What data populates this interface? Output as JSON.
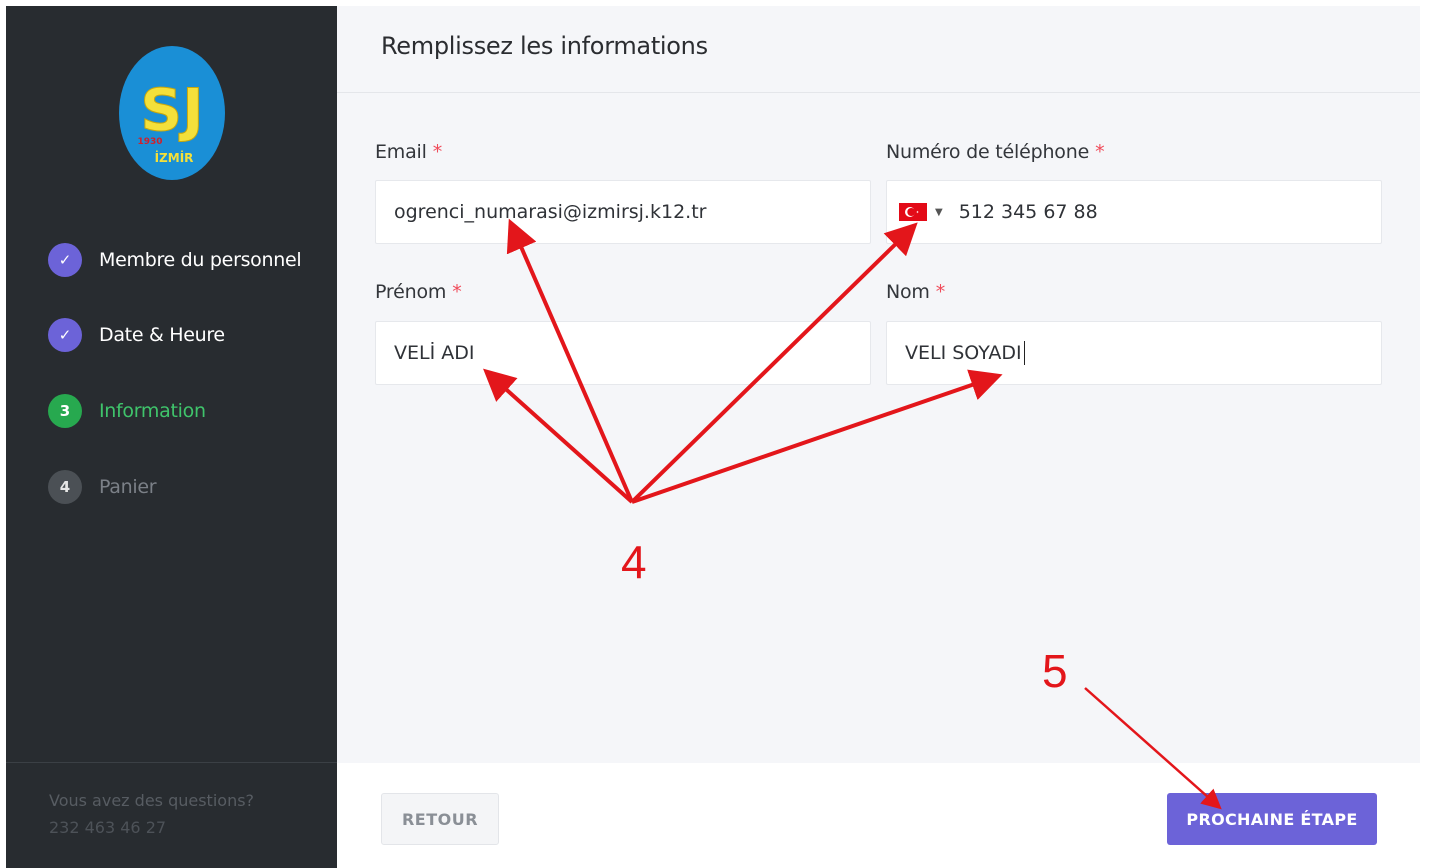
{
  "sidebar": {
    "logo": {
      "letters": "SJ",
      "year": "1930",
      "city": "İZMİR"
    },
    "steps": [
      {
        "number": "✓",
        "label": "Membre du personnel",
        "state": "done"
      },
      {
        "number": "✓",
        "label": "Date & Heure",
        "state": "done"
      },
      {
        "number": "3",
        "label": "Information",
        "state": "active"
      },
      {
        "number": "4",
        "label": "Panier",
        "state": "todo"
      }
    ],
    "help_question": "Vous avez des questions?",
    "help_phone": "232 463 46 27"
  },
  "main": {
    "title": "Remplissez les informations",
    "fields": {
      "email": {
        "label": "Email",
        "required": "*",
        "value": "ogrenci_numarasi@izmirsj.k12.tr"
      },
      "phone": {
        "label": "Numéro de téléphone",
        "required": "*",
        "value": "512 345 67 88",
        "country_icon": "turkey-flag-icon"
      },
      "first_name": {
        "label": "Prénom",
        "required": "*",
        "value": "VELİ ADI"
      },
      "last_name": {
        "label": "Nom",
        "required": "*",
        "value": "VELI SOYADI"
      }
    }
  },
  "footer": {
    "back_label": "RETOUR",
    "next_label": "PROCHAINE ÉTAPE"
  },
  "annotations": {
    "step4": "4",
    "step5": "5",
    "color": "#e3161b"
  },
  "colors": {
    "accent": "#6c63d8",
    "success": "#27a94f",
    "sidebar_bg": "#282c30"
  }
}
